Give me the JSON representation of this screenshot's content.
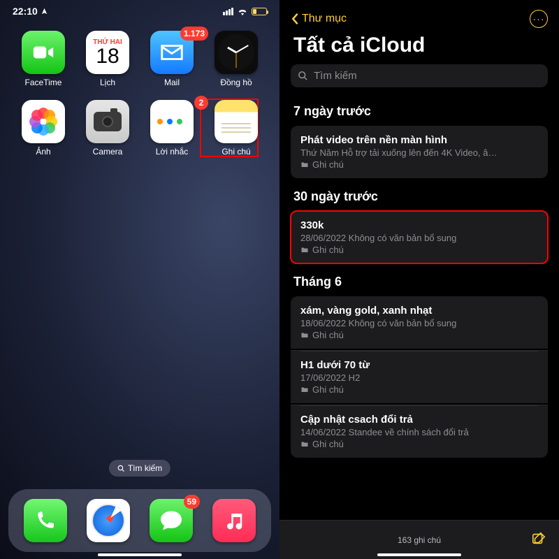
{
  "home": {
    "status": {
      "time": "22:10"
    },
    "apps": {
      "row1": [
        {
          "name": "facetime",
          "label": "FaceTime"
        },
        {
          "name": "calendar",
          "label": "Lịch",
          "dow": "THỨ HAI",
          "day": "18"
        },
        {
          "name": "mail",
          "label": "Mail",
          "badge": "1.173"
        },
        {
          "name": "clock",
          "label": "Đồng hồ"
        }
      ],
      "row2": [
        {
          "name": "photos",
          "label": "Ảnh"
        },
        {
          "name": "camera",
          "label": "Camera"
        },
        {
          "name": "reminders",
          "label": "Lời nhắc",
          "badge": "2"
        },
        {
          "name": "notes",
          "label": "Ghi chú",
          "highlighted": true
        }
      ]
    },
    "search_label": "Tìm kiếm",
    "dock": [
      {
        "name": "phone",
        "label": "Phone"
      },
      {
        "name": "safari",
        "label": "Safari"
      },
      {
        "name": "messages",
        "label": "Messages",
        "badge": "59"
      },
      {
        "name": "music",
        "label": "Music"
      }
    ]
  },
  "notes": {
    "back_label": "Thư mục",
    "title": "Tất cả iCloud",
    "search_placeholder": "Tìm kiếm",
    "sections": [
      {
        "header": "7 ngày trước",
        "items": [
          {
            "title": "Phát video trên nền màn hình",
            "sub": "Thứ Năm  Hỗ trợ tải xuống lên đến 4K Video, â…",
            "folder": "Ghi chú"
          }
        ]
      },
      {
        "header": "30 ngày trước",
        "items": [
          {
            "title": "330k",
            "sub": "28/06/2022  Không có văn bản bổ sung",
            "folder": "Ghi chú",
            "highlighted": true
          }
        ]
      },
      {
        "header": "Tháng 6",
        "items": [
          {
            "title": "xám, vàng gold, xanh nhạt",
            "sub": "18/06/2022  Không có văn bản bổ sung",
            "folder": "Ghi chú"
          },
          {
            "title": "H1 dưới 70 từ",
            "sub": "17/06/2022  H2",
            "folder": "Ghi chú"
          },
          {
            "title": "Cập nhật csach đổi trả",
            "sub": "14/06/2022  Standee về chính sách đổi trả",
            "folder": "Ghi chú"
          }
        ]
      }
    ],
    "footer_count": "163 ghi chú"
  }
}
